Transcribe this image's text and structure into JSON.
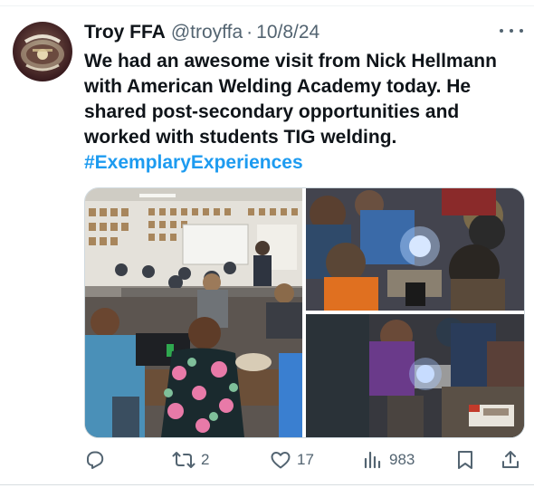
{
  "tweet": {
    "display_name": "Troy FFA",
    "handle": "@troyffa",
    "separator": "·",
    "date": "10/8/24",
    "text": "We had an awesome visit from Nick Hellmann with American Welding Academy today. He shared post-secondary opportunities and worked with students TIG welding.",
    "hashtag": "#ExemplaryExperiences"
  },
  "media": [
    {
      "subject": "classroom"
    },
    {
      "subject": "tig-welding-closeup"
    },
    {
      "subject": "tig-welding-demo"
    }
  ],
  "actions": {
    "reply_icon": "reply-icon",
    "retweet_count": "2",
    "like_count": "17",
    "view_count": "983",
    "bookmark_icon": "bookmark-icon",
    "share_icon": "share-icon"
  },
  "colors": {
    "hashtag": "#1d9bf0",
    "secondary_text": "#536471",
    "primary_text": "#0f1419",
    "avatar_bg": "#3a1c1f"
  }
}
